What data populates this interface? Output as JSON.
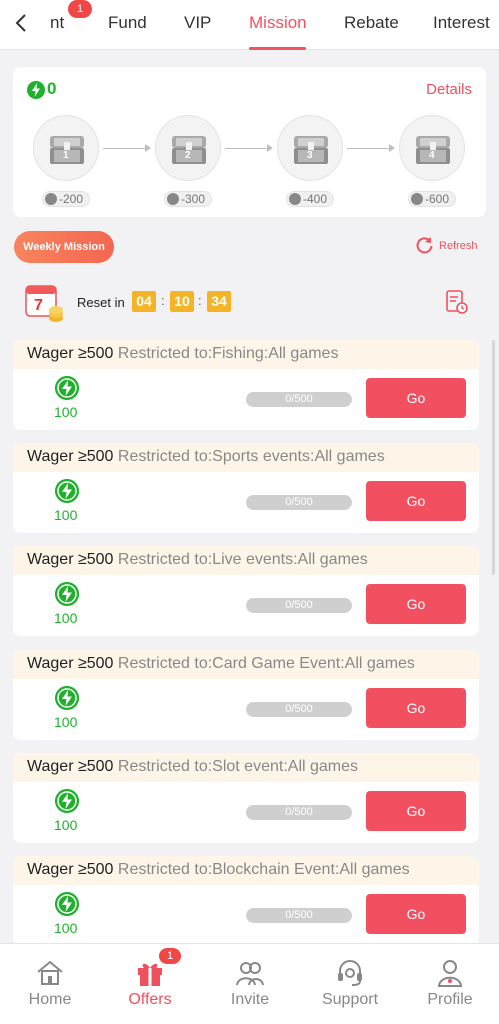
{
  "tabs": [
    {
      "label": "nt",
      "badge": "1"
    },
    {
      "label": "Fund"
    },
    {
      "label": "VIP"
    },
    {
      "label": "Mission",
      "active": true
    },
    {
      "label": "Rebate"
    },
    {
      "label": "Interest"
    }
  ],
  "summary": {
    "points": "0",
    "details_label": "Details",
    "chests": [
      {
        "number": "1",
        "cost": "-200"
      },
      {
        "number": "2",
        "cost": "-300"
      },
      {
        "number": "3",
        "cost": "-400"
      },
      {
        "number": "4",
        "cost": "-600"
      }
    ]
  },
  "weekly": {
    "button_label": "Weekly Mission",
    "refresh_label": "Refresh",
    "reset_label": "Reset in",
    "timer": {
      "days": "04",
      "hours": "10",
      "minutes": "34"
    },
    "colon": ":"
  },
  "missions": [
    {
      "wager": "Wager ≥500",
      "restriction": "Restricted to:Fishing:All games",
      "reward": "100",
      "progress": "0/500",
      "button": "Go"
    },
    {
      "wager": "Wager ≥500",
      "restriction": "Restricted to:Sports events:All games",
      "reward": "100",
      "progress": "0/500",
      "button": "Go"
    },
    {
      "wager": "Wager ≥500",
      "restriction": "Restricted to:Live events:All games",
      "reward": "100",
      "progress": "0/500",
      "button": "Go"
    },
    {
      "wager": "Wager ≥500",
      "restriction": "Restricted to:Card Game Event:All games",
      "reward": "100",
      "progress": "0/500",
      "button": "Go"
    },
    {
      "wager": "Wager ≥500",
      "restriction": "Restricted to:Slot event:All games",
      "reward": "100",
      "progress": "0/500",
      "button": "Go"
    },
    {
      "wager": "Wager ≥500",
      "restriction": "Restricted to:Blockchain Event:All games",
      "reward": "100",
      "progress": "0/500",
      "button": "Go"
    }
  ],
  "bottom_nav": [
    {
      "label": "Home",
      "icon": "home-icon"
    },
    {
      "label": "Offers",
      "icon": "gift-icon",
      "badge": "1",
      "active": true
    },
    {
      "label": "Invite",
      "icon": "people-icon"
    },
    {
      "label": "Support",
      "icon": "headset-icon"
    },
    {
      "label": "Profile",
      "icon": "profile-icon"
    }
  ],
  "colors": {
    "accent": "#f0515e",
    "green": "#1fb12c",
    "timer": "#f5b428",
    "go_button": "#f24f60"
  }
}
